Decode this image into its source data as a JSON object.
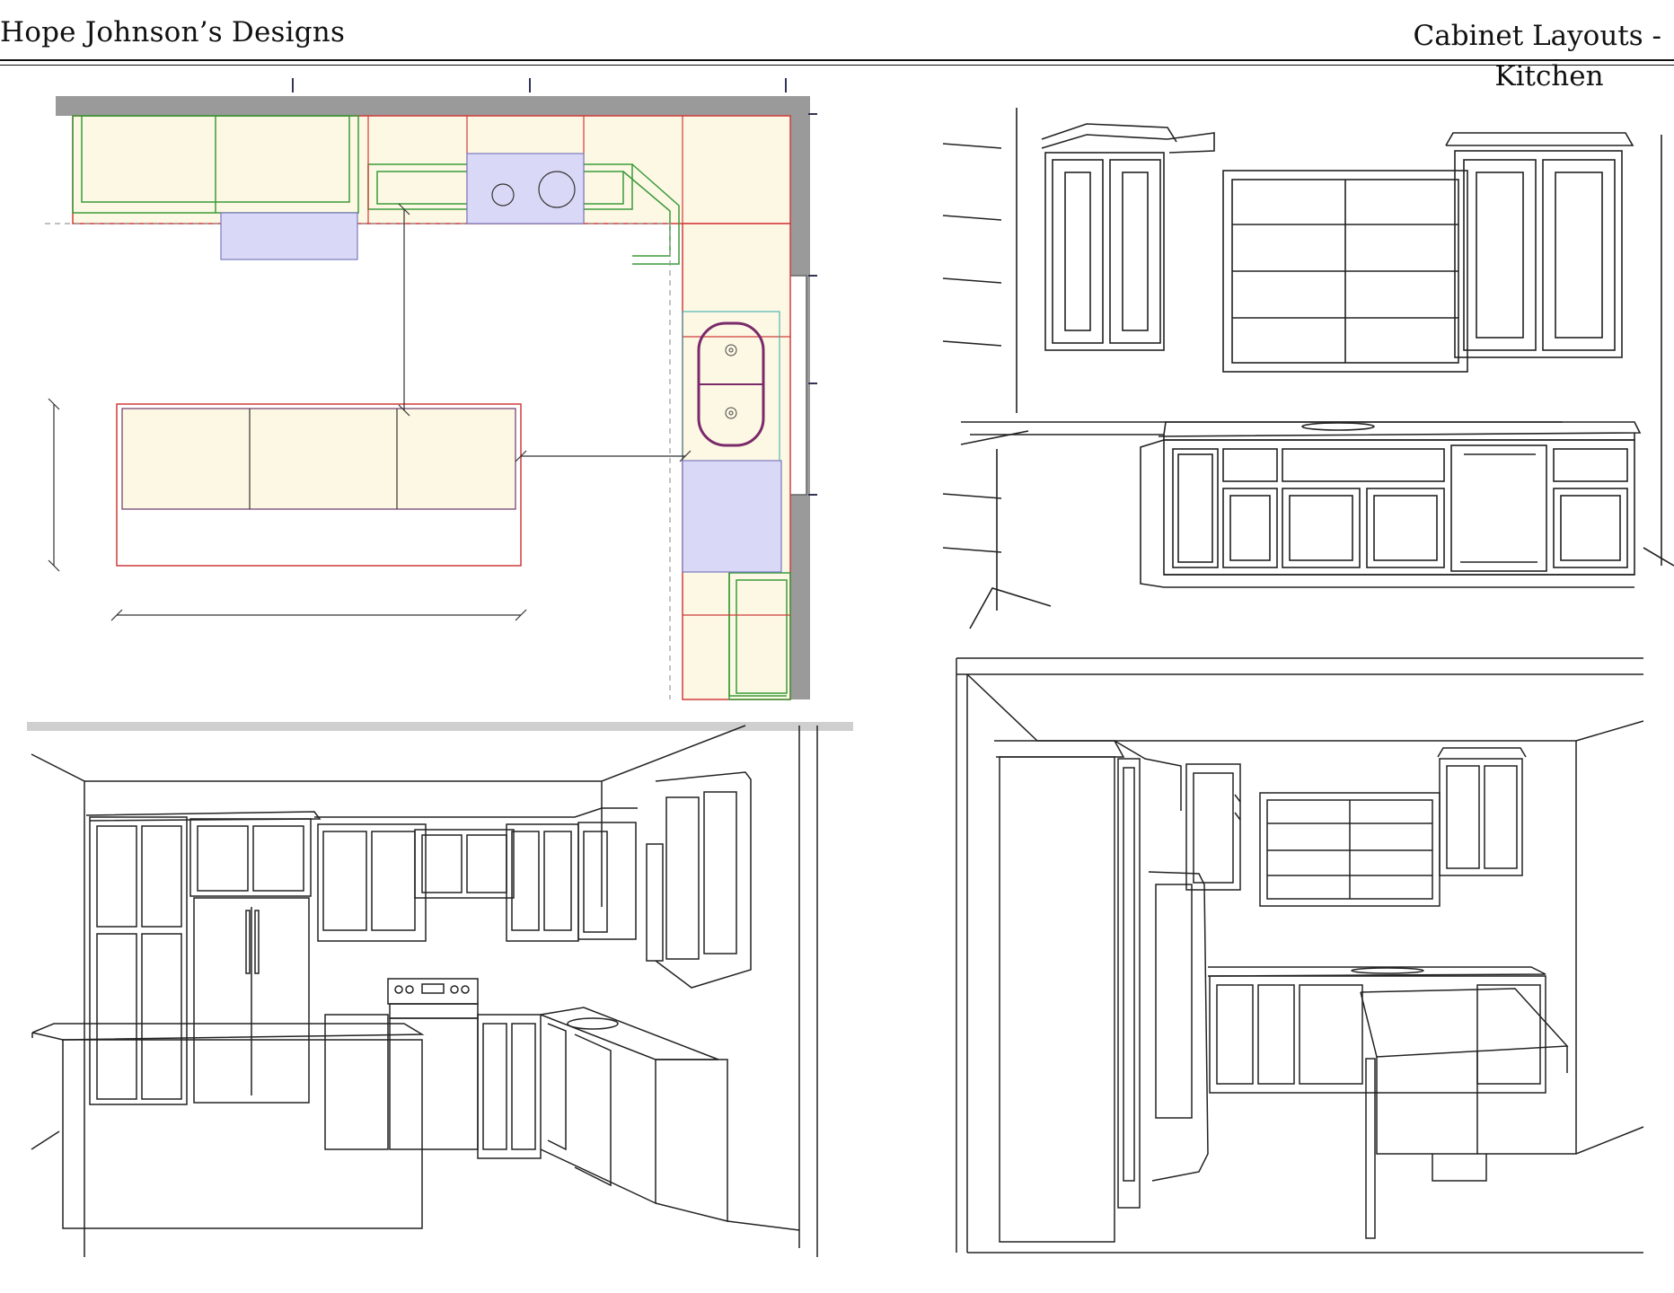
{
  "header": {
    "designer": "Hope Johnson’s Designs",
    "title_line1": "Cabinet Layouts -",
    "title_line2": "Kitchen"
  },
  "colors": {
    "cabinet_fill": "#fdf8e4",
    "appliance_fill": "#d9d9f7",
    "upper_outline": "#3a9a3a",
    "base_outline": "#d03b3b",
    "sink_outline": "#7a2a6a",
    "wall": "#9a9a9a",
    "line": "#222222"
  },
  "panels": [
    {
      "id": "floor-plan",
      "view": "plan"
    },
    {
      "id": "sink-wall-elevation",
      "view": "elevation"
    },
    {
      "id": "perspective-left",
      "view": "3d"
    },
    {
      "id": "perspective-right",
      "view": "3d"
    }
  ]
}
